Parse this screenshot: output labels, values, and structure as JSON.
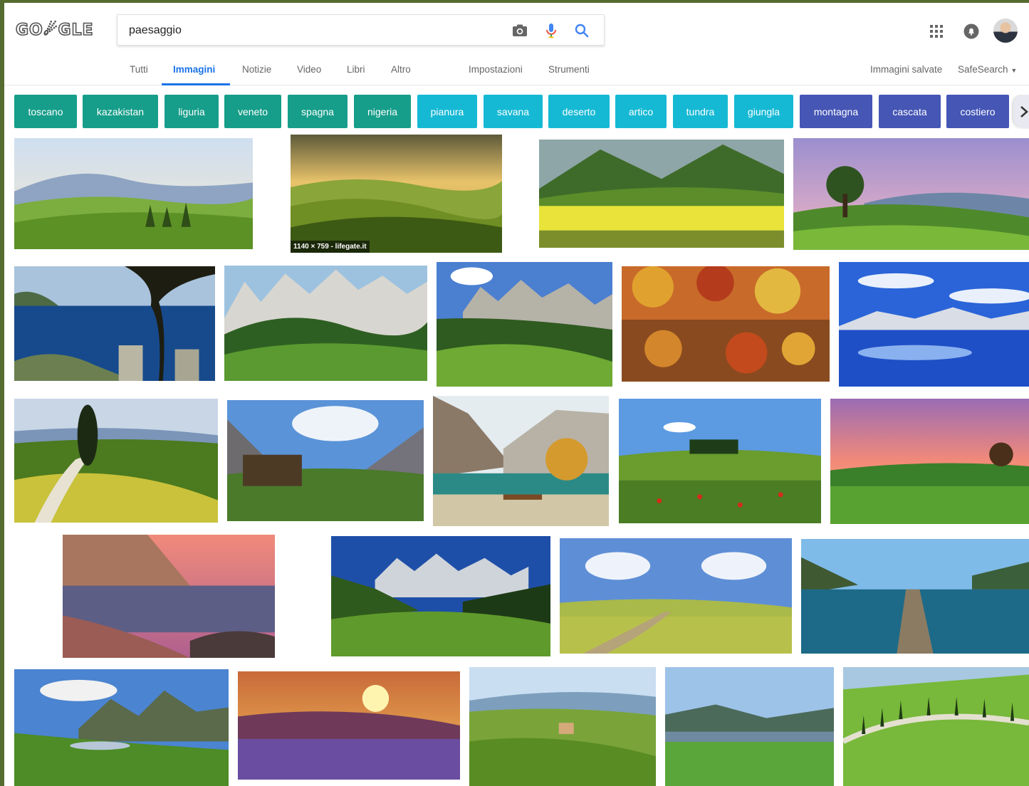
{
  "logo": {
    "text": "GO☄GLE",
    "alt": "Google"
  },
  "search": {
    "value": "paesaggio",
    "placeholder": ""
  },
  "icons": {
    "camera": "camera-icon",
    "mic": "microphone-icon",
    "search": "search-icon",
    "apps": "apps-grid-icon",
    "notifications": "notifications-icon"
  },
  "tabs": [
    {
      "label": "Tutti",
      "active": false
    },
    {
      "label": "Immagini",
      "active": true
    },
    {
      "label": "Notizie",
      "active": false
    },
    {
      "label": "Video",
      "active": false
    },
    {
      "label": "Libri",
      "active": false
    },
    {
      "label": "Altro",
      "active": false
    },
    {
      "label": "Impostazioni",
      "active": false
    },
    {
      "label": "Strumenti",
      "active": false
    }
  ],
  "header_right": {
    "saved": "Immagini salvate",
    "safesearch": "SafeSearch"
  },
  "chips": [
    {
      "label": "toscano",
      "color": "#169e8a"
    },
    {
      "label": "kazakistan",
      "color": "#169e8a"
    },
    {
      "label": "liguria",
      "color": "#169e8a"
    },
    {
      "label": "veneto",
      "color": "#169e8a"
    },
    {
      "label": "spagna",
      "color": "#169e8a"
    },
    {
      "label": "nigeria",
      "color": "#169e8a"
    },
    {
      "label": "pianura",
      "color": "#16b9d4"
    },
    {
      "label": "savana",
      "color": "#16b9d4"
    },
    {
      "label": "deserto",
      "color": "#16b9d4"
    },
    {
      "label": "artico",
      "color": "#16b9d4"
    },
    {
      "label": "tundra",
      "color": "#16b9d4"
    },
    {
      "label": "giungla",
      "color": "#16b9d4"
    },
    {
      "label": "montagna",
      "color": "#4556b5"
    },
    {
      "label": "cascata",
      "color": "#4556b5"
    },
    {
      "label": "costiero",
      "color": "#4556b5"
    }
  ],
  "images": [
    {
      "caption": ""
    },
    {
      "caption": "1140 × 759 - lifegate.it"
    }
  ]
}
